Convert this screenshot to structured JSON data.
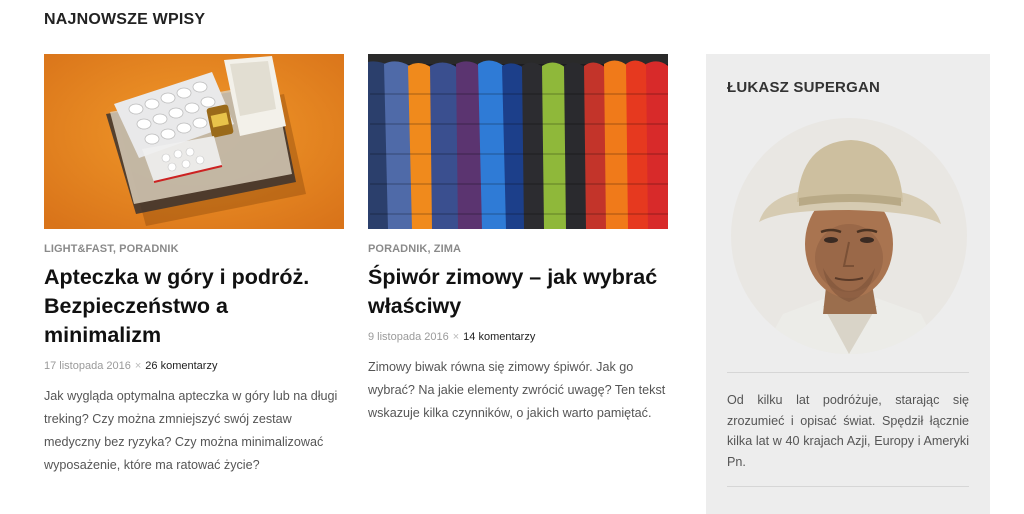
{
  "section": {
    "title": "NAJNOWSZE WPISY"
  },
  "posts": [
    {
      "categories": [
        "LIGHT&FAST",
        "PORADNIK"
      ],
      "title": "Apteczka w góry i podróż. Bezpieczeństwo a minimalizm",
      "date": "17 listopada 2016",
      "separator": "×",
      "comments": "26 komentarzy",
      "excerpt": "Jak wygląda optymalna apteczka w góry lub na długi treking? Czy można zmniejszyć swój zestaw medyczny bez ryzyka? Czy można minimalizować wyposażenie, które ma ratować życie?"
    },
    {
      "categories": [
        "PORADNIK",
        "ZIMA"
      ],
      "title": "Śpiwór zimowy – jak wybrać właściwy",
      "date": "9 listopada 2016",
      "separator": "×",
      "comments": "14 komentarzy",
      "excerpt": "Zimowy biwak równa się zimowy śpiwór. Jak go wybrać? Na jakie elementy zwrócić uwagę? Ten tekst wskazuje kilka czynników, o jakich warto pamiętać."
    }
  ],
  "sidebar": {
    "author_name": "ŁUKASZ SUPERGAN",
    "bio": "Od kilku lat podróżuje, starając się zrozumieć i opisać świat. Spędził łącznie kilka lat w 40 krajach Azji, Europy i Ameryki Pn."
  },
  "colors": {
    "category_text": "#8a8a8a",
    "sidebar_bg": "#ededed",
    "thumb1_bg": "#e8891c",
    "title_text": "#111111"
  },
  "icons": {
    "post1_image": "first-aid-kit-photo",
    "post2_image": "down-jackets-photo",
    "author_image": "author-portrait-photo"
  }
}
